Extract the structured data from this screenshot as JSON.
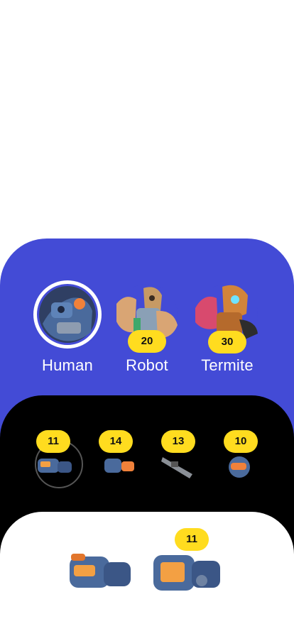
{
  "characters": [
    {
      "name": "Human",
      "badge": "",
      "selected": true
    },
    {
      "name": "Robot",
      "badge": "20",
      "selected": false
    },
    {
      "name": "Termite",
      "badge": "30",
      "selected": false
    }
  ],
  "parts": [
    {
      "badge": "11",
      "icon": "gauntlet-icon",
      "selected": true
    },
    {
      "badge": "14",
      "icon": "arm-icon",
      "selected": false
    },
    {
      "badge": "13",
      "icon": "rifle-icon",
      "selected": false
    },
    {
      "badge": "10",
      "icon": "helmet-icon",
      "selected": false
    }
  ],
  "equipment": [
    {
      "badge": "",
      "icon": "armor-gauntlet-icon"
    },
    {
      "badge": "11",
      "icon": "shield-gauntlet-icon"
    }
  ],
  "colors": {
    "blue_panel": "#434bd6",
    "badge": "#ffdc1f",
    "selection_ring": "#ffffff"
  }
}
